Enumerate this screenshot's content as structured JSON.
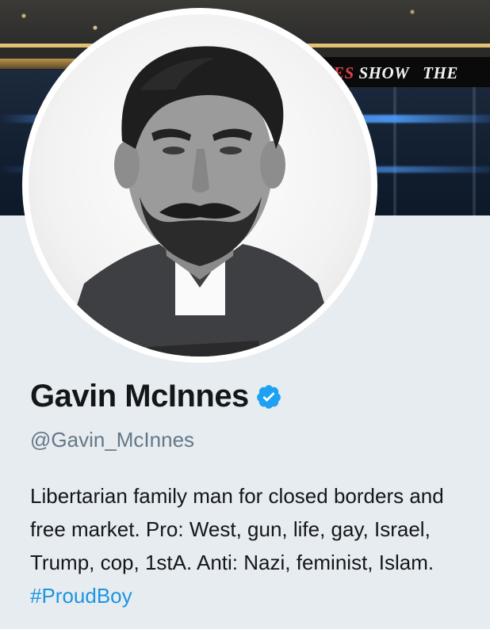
{
  "banner": {
    "sign_text_accent": "ES",
    "sign_text": " SHOW   THE"
  },
  "profile": {
    "name": "Gavin McInnes",
    "verified": true,
    "handle": "@Gavin_McInnes",
    "bio_text": "Libertarian family man for closed borders and free market. Pro: West, gun, life, gay, Israel, Trump, cop, 1stA. Anti: Nazi, feminist, Islam. ",
    "bio_hashtag": "#ProudBoy"
  },
  "colors": {
    "background": "#e6ecf0",
    "text_primary": "#14171a",
    "text_secondary": "#657786",
    "link": "#1b95e0",
    "verified_badge": "#1da1f2"
  },
  "icons": {
    "verified": "verified-badge-icon"
  }
}
